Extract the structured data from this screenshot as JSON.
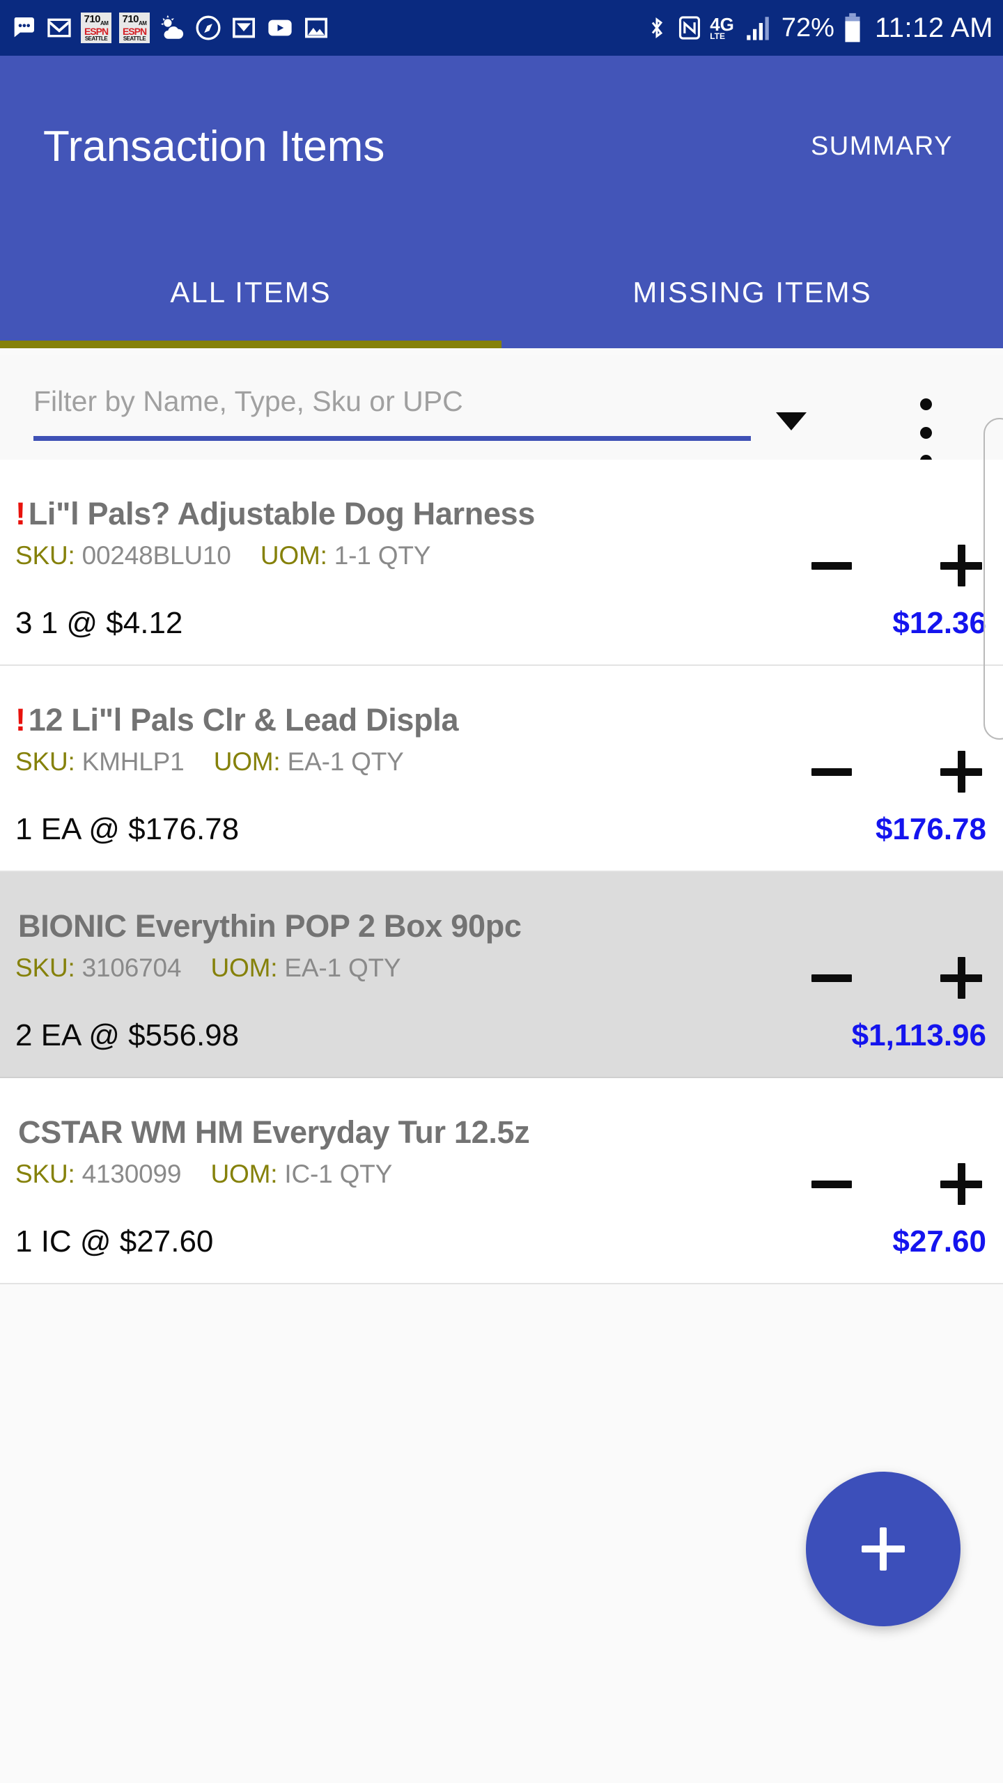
{
  "status_bar": {
    "icons": [
      "messages-icon",
      "gmail-icon",
      "espn-radio-icon",
      "espn-radio-icon",
      "weather-icon",
      "compass-icon",
      "inbox-icon",
      "youtube-icon",
      "photo-icon",
      "bluetooth-icon",
      "nfc-icon"
    ],
    "espn_badge": {
      "line1": "710",
      "line1_suffix": "AM",
      "line2": "ESPN",
      "line3": "SEATTLE"
    },
    "network": {
      "label": "4G",
      "sub": "LTE"
    },
    "signal_icon": "signal-bars-icon",
    "battery_percent": "72%",
    "battery_icon": "battery-icon",
    "clock": "11:12 AM",
    "background": "#0a2a80"
  },
  "app_bar": {
    "title": "Transaction Items",
    "action_label": "SUMMARY",
    "background": "#4355b8",
    "tabs": [
      {
        "label": "ALL ITEMS",
        "active": true
      },
      {
        "label": "MISSING ITEMS",
        "active": false
      }
    ],
    "active_tab_indicator_color": "#85810a"
  },
  "filter_bar": {
    "placeholder": "Filter by Name, Type, Sku or UPC",
    "value": "",
    "underline_color": "#3f51b5",
    "dropdown_icon": "chevron-down-icon",
    "overflow_icon": "more-vertical-icon"
  },
  "list": {
    "meta_labels": {
      "sku": "SKU:",
      "uom": "UOM:"
    },
    "stepper": {
      "decrement_icon": "minus-icon",
      "increment_icon": "plus-icon"
    },
    "price_color": "#1414ee",
    "label_color": "#85810a",
    "alert_color": "#e8120c",
    "items": [
      {
        "alert": "!",
        "name": "Li\"l Pals? Adjustable Dog Harness",
        "sku": "00248BLU10",
        "uom": "1-1 QTY",
        "qty_line": "3 1 @ $4.12",
        "total": "$12.36",
        "highlighted": false
      },
      {
        "alert": "!",
        "name": "12 Li\"l Pals Clr & Lead Displa",
        "sku": "KMHLP1",
        "uom": "EA-1 QTY",
        "qty_line": "1 EA @ $176.78",
        "total": "$176.78",
        "highlighted": false
      },
      {
        "alert": "",
        "name": "BIONIC Everythin POP 2 Box 90pc",
        "sku": "3106704",
        "uom": "EA-1 QTY",
        "qty_line": "2 EA @ $556.98",
        "total": "$1,113.96",
        "highlighted": true
      },
      {
        "alert": "",
        "name": "CSTAR WM HM Everyday Tur  12.5z",
        "sku": "4130099",
        "uom": "IC-1 QTY",
        "qty_line": "1 IC @ $27.60",
        "total": "$27.60",
        "highlighted": false
      }
    ]
  },
  "fab": {
    "icon": "plus-icon",
    "color": "#3c4fba"
  },
  "scrollbar": {
    "icon": "scrollbar-thumb"
  }
}
